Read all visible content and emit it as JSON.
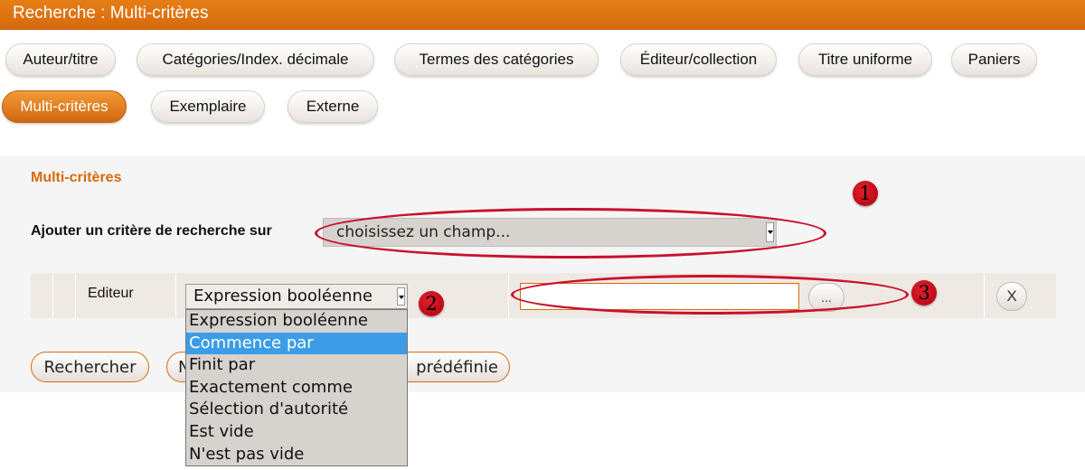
{
  "window": {
    "title": "Recherche : Multi-critères"
  },
  "tabs": [
    {
      "label": "Auteur/titre",
      "active": false
    },
    {
      "label": "Catégories/Index. décimale",
      "active": false
    },
    {
      "label": "Termes des catégories",
      "active": false
    },
    {
      "label": "Éditeur/collection",
      "active": false
    },
    {
      "label": "Titre uniforme",
      "active": false
    },
    {
      "label": "Paniers",
      "active": false
    },
    {
      "label": "Multi-critères",
      "active": true
    },
    {
      "label": "Exemplaire",
      "active": false
    },
    {
      "label": "Externe",
      "active": false
    }
  ],
  "panel": {
    "title": "Multi-critères",
    "add_criterion_label": "Ajouter un critère de recherche sur",
    "field_select_value": "choisissez un champ..."
  },
  "criterion": {
    "field_label": "Editeur",
    "operator_value": "Expression booléenne",
    "value_input": "",
    "ellipsis_label": "...",
    "remove_label": "X"
  },
  "operator_options": [
    {
      "label": "Expression booléenne",
      "highlighted": false
    },
    {
      "label": "Commence par",
      "highlighted": true
    },
    {
      "label": "Finit par",
      "highlighted": false
    },
    {
      "label": "Exactement comme",
      "highlighted": false
    },
    {
      "label": "Sélection d'autorité",
      "highlighted": false
    },
    {
      "label": "Est vide",
      "highlighted": false
    },
    {
      "label": "N'est pas vide",
      "highlighted": false
    }
  ],
  "buttons": {
    "search": "Rechercher",
    "second_partial": "N",
    "third_partial": "prédéfinie"
  },
  "annotations": {
    "m1": "1",
    "m2": "2",
    "m3": "3"
  },
  "colors": {
    "accent": "#d76a0d",
    "annotation": "#c8102e",
    "highlight": "#3c9de6"
  }
}
